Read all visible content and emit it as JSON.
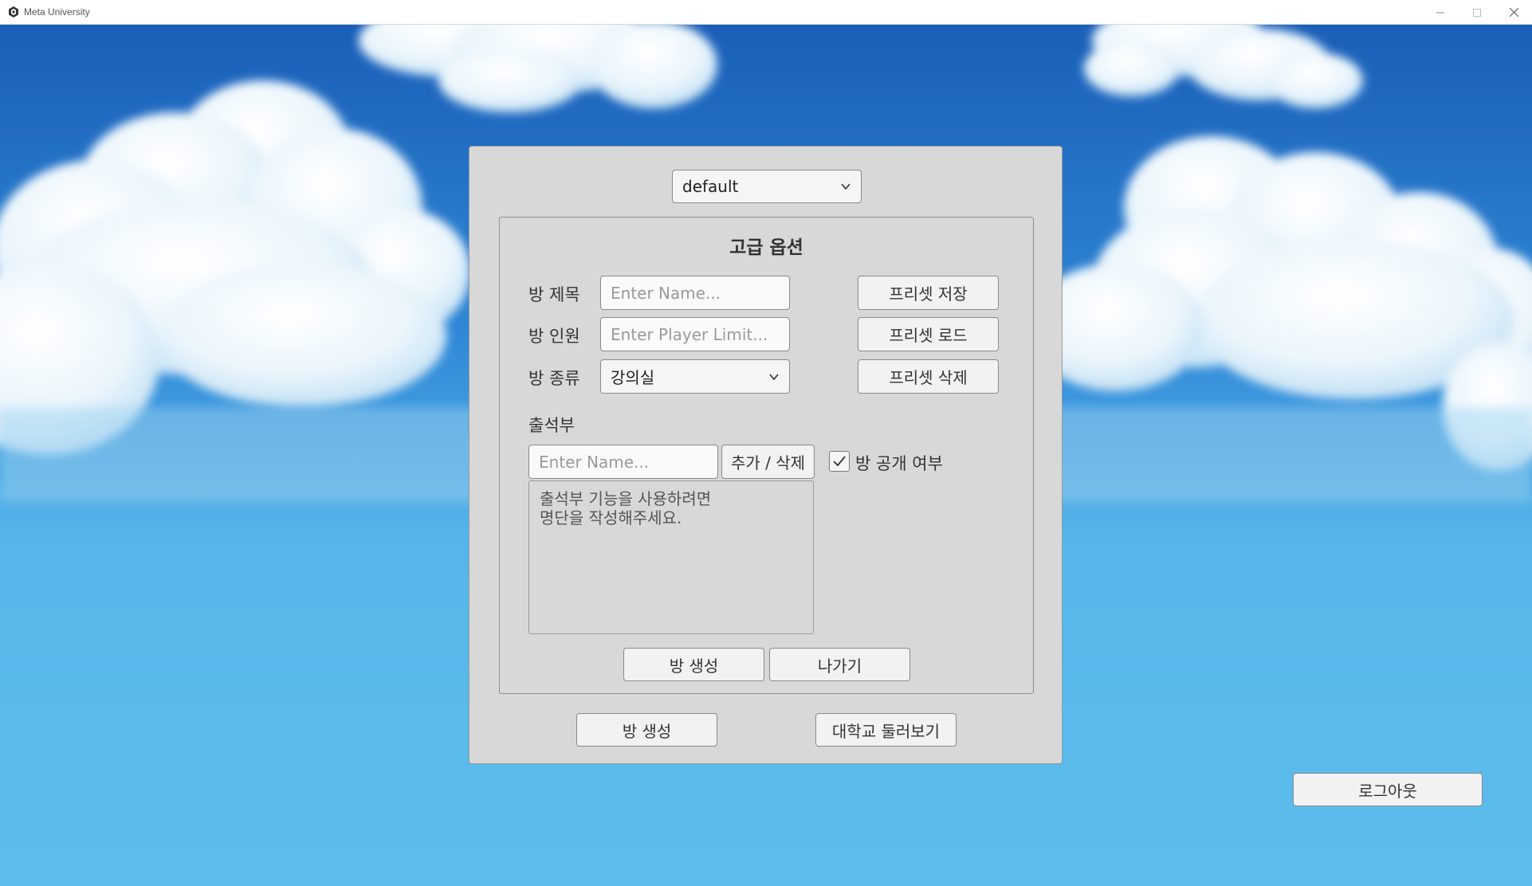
{
  "window": {
    "title": "Meta University"
  },
  "preset_select": {
    "value": "default"
  },
  "advanced": {
    "title": "고급 옵션",
    "room_title_label": "방 제목",
    "room_title_placeholder": "Enter Name...",
    "room_limit_label": "방 인원",
    "room_limit_placeholder": "Enter Player Limit...",
    "room_type_label": "방 종류",
    "room_type_value": "강의실",
    "preset_save": "프리셋 저장",
    "preset_load": "프리셋 로드",
    "preset_delete": "프리셋 삭제",
    "attendance_label": "출석부",
    "attendance_placeholder": "Enter Name...",
    "add_remove": "추가 / 삭제",
    "public_label": "방 공개 여부",
    "public_checked": true,
    "attendance_text": "출석부 기능을 사용하려면\n명단을 작성해주세요.",
    "create_button": "방 생성",
    "exit_button": "나가기"
  },
  "bottom": {
    "create_button": "방 생성",
    "tour_button": "대학교 둘러보기"
  },
  "logout_button": "로그아웃",
  "colors": {
    "sky_top": "#1a5fb8",
    "sky_bottom": "#5bbcec",
    "panel": "#d8d8d8"
  }
}
